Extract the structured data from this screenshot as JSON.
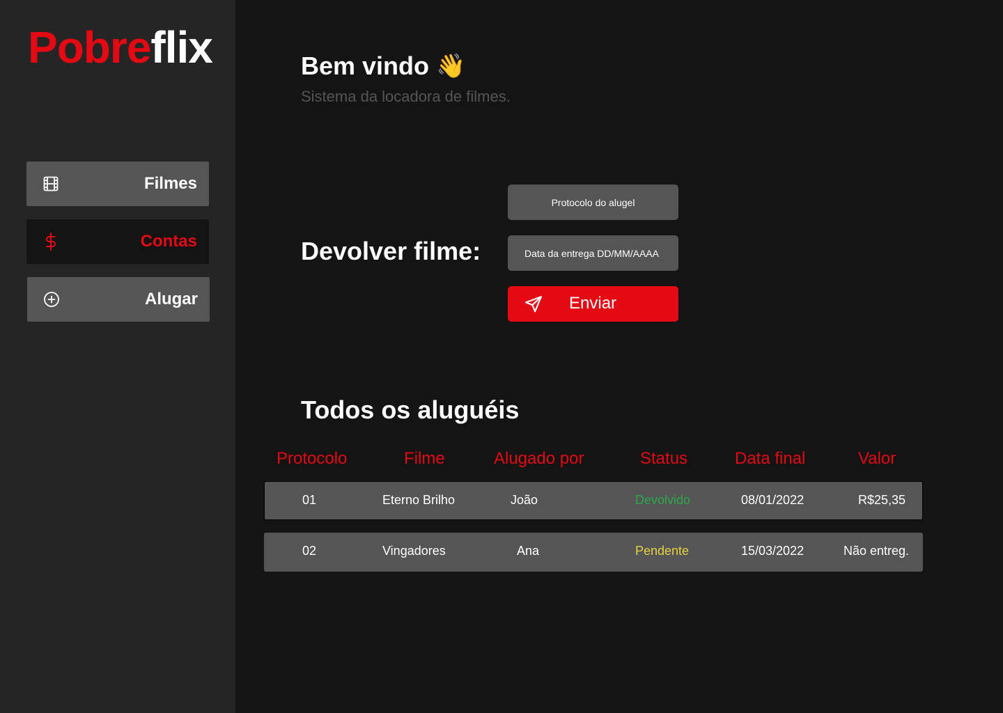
{
  "brand": {
    "logo_part1": "Pobre",
    "logo_part2": "flix",
    "accent": "#e50914"
  },
  "sidebar": {
    "items": [
      {
        "label": "Filmes",
        "icon": "film-icon",
        "active": false
      },
      {
        "label": "Contas",
        "icon": "dollar-icon",
        "active": true
      },
      {
        "label": "Alugar",
        "icon": "plus-circle-icon",
        "active": false
      }
    ]
  },
  "welcome": {
    "title": "Bem vindo",
    "emoji": "👋",
    "subtitle": "Sistema da locadora de filmes."
  },
  "return_form": {
    "title": "Devolver filme:",
    "protocol_placeholder": "Protocolo do alugel",
    "date_placeholder": "Data da entrega DD/MM/AAAA",
    "submit_label": "Enviar",
    "submit_icon": "send-icon"
  },
  "rentals": {
    "title": "Todos os aluguéis",
    "headers": [
      "Protocolo",
      "Filme",
      "Alugado por",
      "Status",
      "Data final",
      "Valor"
    ],
    "rows": [
      {
        "protocolo": "01",
        "filme": "Eterno Brilho",
        "alugado_por": "João",
        "status": "Devolvido",
        "data_final": "08/01/2022",
        "valor": "R$25,35"
      },
      {
        "protocolo": "02",
        "filme": "Vingadores",
        "alugado_por": "Ana",
        "status": "Pendente",
        "data_final": "15/03/2022",
        "valor": "Não entreg."
      }
    ]
  },
  "colors": {
    "status_returned": "#2ea84a",
    "status_pending": "#e5d142",
    "sidebar_bg": "#252525",
    "main_bg": "#141414",
    "button_bg": "#555555"
  }
}
